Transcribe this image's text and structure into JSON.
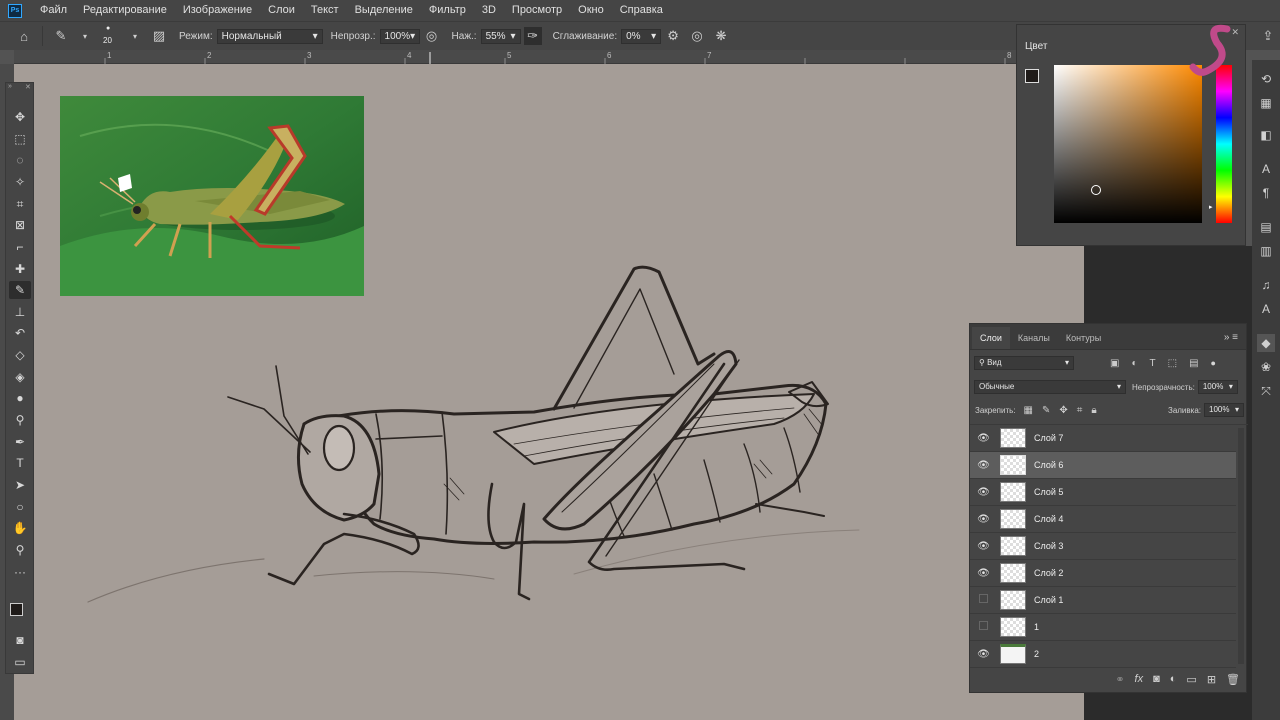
{
  "menu": [
    "Файл",
    "Редактирование",
    "Изображение",
    "Слои",
    "Текст",
    "Выделение",
    "Фильтр",
    "3D",
    "Просмотр",
    "Окно",
    "Справка"
  ],
  "app_logo": "Ps",
  "options": {
    "brush_size": "20",
    "mode_label": "Режим:",
    "mode_value": "Нормальный",
    "opacity_label": "Непрозр.:",
    "opacity_value": "100%",
    "pressure_label": "Наж.:",
    "pressure_value": "55%",
    "smoothing_label": "Сглаживание:",
    "smoothing_value": "0%"
  },
  "ruler_numbers": [
    "1",
    "2",
    "3",
    "4",
    "5",
    "6",
    "7",
    "8"
  ],
  "color_panel": {
    "title": "Цвет",
    "foreground": "#1f1b19",
    "background": "#ffffff",
    "hue": "#ff8a00"
  },
  "layers_panel": {
    "tabs": [
      "Слои",
      "Каналы",
      "Контуры"
    ],
    "filter_value": "Вид",
    "blend_mode": "Обычные",
    "opacity_label": "Непрозрачность:",
    "opacity_value": "100%",
    "lock_label": "Закрепить:",
    "fill_label": "Заливка:",
    "fill_value": "100%",
    "layers": [
      {
        "name": "Слой 7",
        "visible": true,
        "selected": false
      },
      {
        "name": "Слой 6",
        "visible": true,
        "selected": true
      },
      {
        "name": "Слой 5",
        "visible": true,
        "selected": false
      },
      {
        "name": "Слой 4",
        "visible": true,
        "selected": false
      },
      {
        "name": "Слой 3",
        "visible": true,
        "selected": false
      },
      {
        "name": "Слой 2",
        "visible": true,
        "selected": false
      },
      {
        "name": "Слой 1",
        "visible": false,
        "selected": false
      },
      {
        "name": "1",
        "visible": false,
        "selected": false
      },
      {
        "name": "2",
        "visible": true,
        "selected": false
      }
    ]
  },
  "tools": [
    "move-tool",
    "marquee-tool",
    "lasso-tool",
    "quick-select-tool",
    "crop-tool",
    "frame-tool",
    "eyedropper-tool",
    "healing-tool",
    "brush-tool",
    "stamp-tool",
    "history-brush-tool",
    "eraser-tool",
    "gradient-tool",
    "blur-tool",
    "dodge-tool",
    "pen-tool",
    "type-tool",
    "path-select-tool",
    "shape-tool",
    "hand-tool",
    "zoom-tool",
    "more-tools"
  ]
}
